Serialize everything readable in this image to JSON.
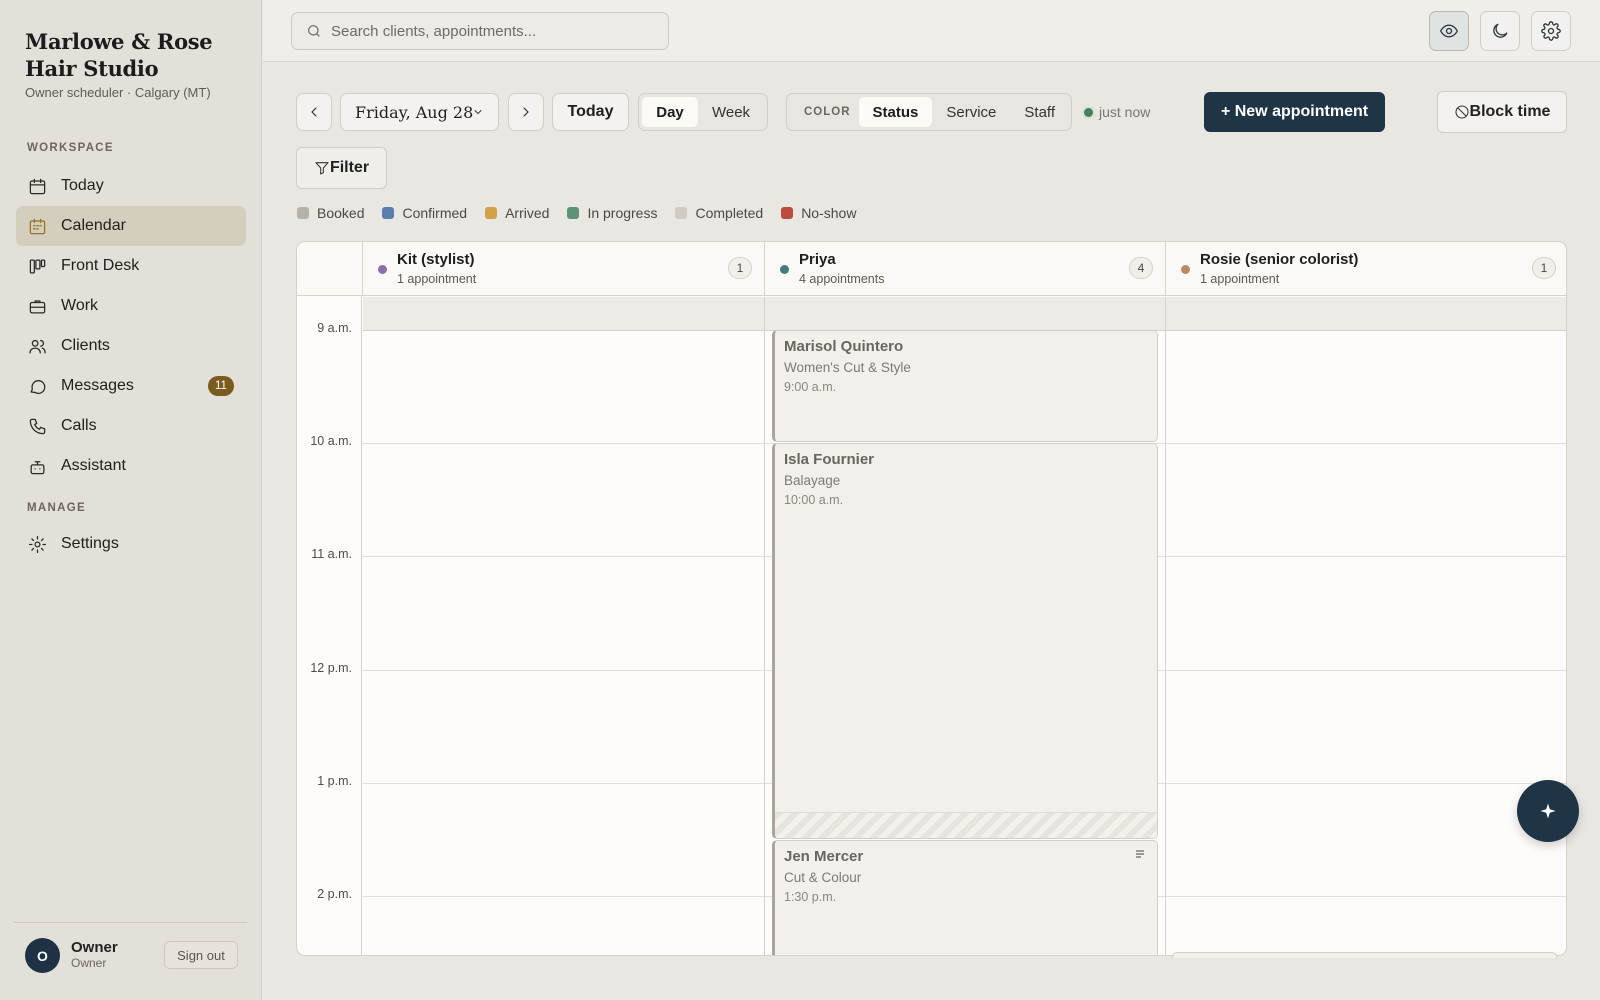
{
  "brand": {
    "name": "Marlowe & Rose Hair Studio",
    "subtitle": "Owner scheduler · Calgary (MT)"
  },
  "sidebar": {
    "workspace_label": "WORKSPACE",
    "manage_label": "MANAGE",
    "items": [
      {
        "label": "Today",
        "icon": "calendar-icon"
      },
      {
        "label": "Calendar",
        "icon": "calendar-grid-icon",
        "active": true
      },
      {
        "label": "Front Desk",
        "icon": "board-icon"
      },
      {
        "label": "Work",
        "icon": "briefcase-icon"
      },
      {
        "label": "Clients",
        "icon": "users-icon"
      },
      {
        "label": "Messages",
        "icon": "chat-icon",
        "badge": "11"
      },
      {
        "label": "Calls",
        "icon": "phone-icon"
      },
      {
        "label": "Assistant",
        "icon": "bot-icon"
      }
    ],
    "manage_items": [
      {
        "label": "Settings",
        "icon": "gear-icon"
      }
    ]
  },
  "user": {
    "initial": "O",
    "name": "Owner",
    "role": "Owner",
    "signout_label": "Sign out"
  },
  "search": {
    "placeholder": "Search clients, appointments..."
  },
  "toolbar": {
    "date": "Friday, Aug 28",
    "today_label": "Today",
    "view_options": [
      "Day",
      "Week"
    ],
    "view_selected": "Day",
    "color_label": "COLOR",
    "color_options": [
      "Status",
      "Service",
      "Staff"
    ],
    "color_selected": "Status",
    "live_status": "just now",
    "new_appointment_label": "+ New appointment",
    "block_time_label": "Block time",
    "filter_label": "Filter"
  },
  "legend": [
    {
      "label": "Booked",
      "color": "#b7b1a8"
    },
    {
      "label": "Confirmed",
      "color": "#5a7fae"
    },
    {
      "label": "Arrived",
      "color": "#d4a04a"
    },
    {
      "label": "In progress",
      "color": "#5e9272"
    },
    {
      "label": "Completed",
      "color": "#cfcbc3"
    },
    {
      "label": "No-show",
      "color": "#bf4a3e"
    }
  ],
  "calendar": {
    "hours": [
      "9 a.m.",
      "10 a.m.",
      "11 a.m.",
      "12 p.m.",
      "1 p.m.",
      "2 p.m."
    ],
    "staff": [
      {
        "name": "Kit (stylist)",
        "sub": "1 appointment",
        "count": "1",
        "color": "#8e6fa8"
      },
      {
        "name": "Priya",
        "sub": "4 appointments",
        "count": "4",
        "color": "#3f7c7c"
      },
      {
        "name": "Rosie (senior colorist)",
        "sub": "1 appointment",
        "count": "1",
        "color": "#b98a63"
      }
    ],
    "appointments": [
      {
        "client": "Marisol Quintero",
        "service": "Women's Cut & Style",
        "time": "9:00 a.m."
      },
      {
        "client": "Isla Fournier",
        "service": "Balayage",
        "time": "10:00 a.m."
      },
      {
        "client": "Jen Mercer",
        "service": "Cut & Colour",
        "time": "1:30 p.m."
      }
    ]
  }
}
